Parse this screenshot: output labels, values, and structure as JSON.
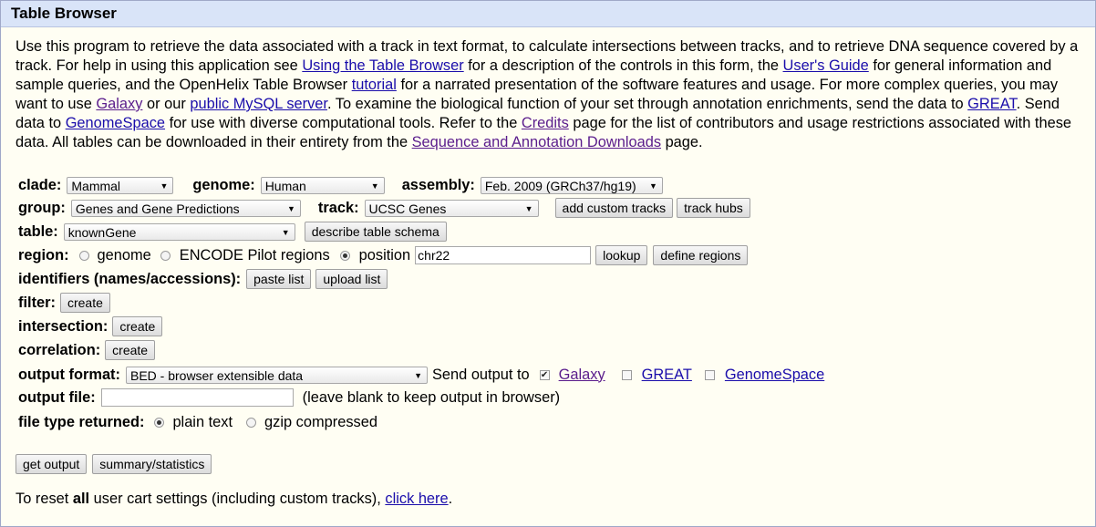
{
  "window": {
    "title": "Table Browser"
  },
  "intro": {
    "t1": "Use this program to retrieve the data associated with a track in text format, to calculate intersections between tracks, and to retrieve DNA sequence covered by a track. For help in using this application see ",
    "link_using": "Using the Table Browser",
    "t2": " for a description of the controls in this form, the ",
    "link_guide": "User's Guide",
    "t3": " for general information and sample queries, and the OpenHelix Table Browser ",
    "link_tutorial": "tutorial",
    "t4": " for a narrated presentation of the software features and usage. For more complex queries, you may want to use ",
    "link_galaxy": "Galaxy",
    "t5": " or our ",
    "link_mysql": "public MySQL server",
    "t6": ". To examine the biological function of your set through annotation enrichments, send the data to ",
    "link_great": "GREAT",
    "t7": ". Send data to ",
    "link_genomespace": "GenomeSpace",
    "t8": " for use with diverse computational tools. Refer to the ",
    "link_credits": "Credits",
    "t9": " page for the list of contributors and usage restrictions associated with these data. All tables can be downloaded in their entirety from the ",
    "link_downloads": "Sequence and Annotation Downloads",
    "t10": " page."
  },
  "form": {
    "clade_label": "clade:",
    "clade_value": "Mammal",
    "genome_label": "genome:",
    "genome_value": "Human",
    "assembly_label": "assembly:",
    "assembly_value": "Feb. 2009 (GRCh37/hg19)",
    "group_label": "group:",
    "group_value": "Genes and Gene Predictions",
    "track_label": "track:",
    "track_value": "UCSC Genes",
    "add_custom_tracks": "add custom tracks",
    "track_hubs": "track hubs",
    "table_label": "table:",
    "table_value": "knownGene",
    "describe_schema": "describe table schema",
    "region_label": "region:",
    "region_genome": "genome",
    "region_encode": "ENCODE Pilot regions",
    "region_position": "position",
    "position_value": "chr22",
    "lookup": "lookup",
    "define_regions": "define regions",
    "identifiers_label": "identifiers (names/accessions):",
    "paste_list": "paste list",
    "upload_list": "upload list",
    "filter_label": "filter:",
    "create": "create",
    "intersection_label": "intersection:",
    "correlation_label": "correlation:",
    "output_format_label": "output format:",
    "output_format_value": "BED - browser extensible data",
    "send_output_to": "Send output to",
    "send_galaxy": "Galaxy",
    "send_great": "GREAT",
    "send_genomespace": "GenomeSpace",
    "output_file_label": "output file:",
    "output_file_value": "",
    "output_file_note": "(leave blank to keep output in browser)",
    "file_type_label": "file type returned:",
    "plain_text": "plain text",
    "gzip": "gzip compressed",
    "get_output": "get output",
    "summary_stats": "summary/statistics"
  },
  "reset": {
    "t1": "To reset ",
    "bold": "all",
    "t2": " user cart settings (including custom tracks), ",
    "link": "click here",
    "t3": "."
  }
}
